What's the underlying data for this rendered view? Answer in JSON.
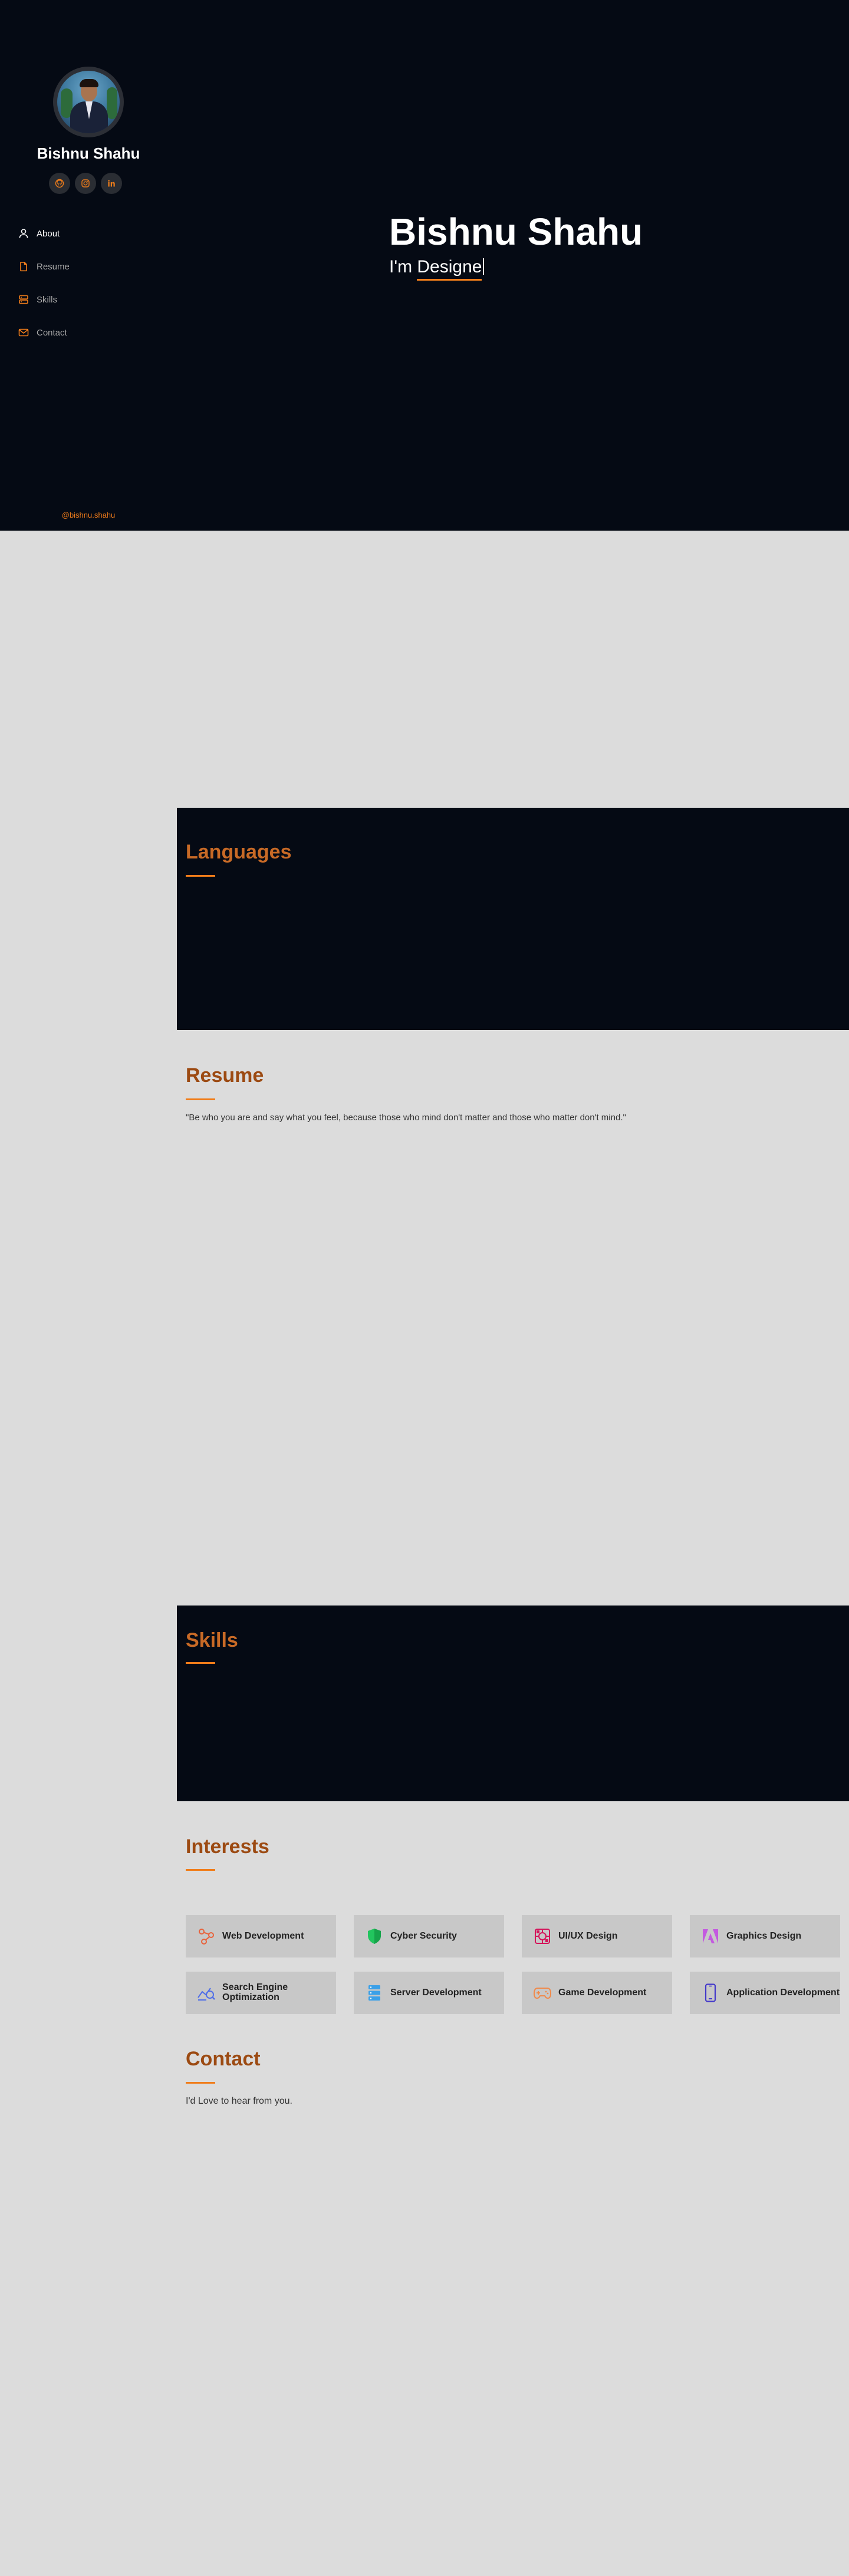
{
  "profile": {
    "name": "Bishnu Shahu",
    "footer_handle": "@bishnu.shahu"
  },
  "socials": [
    {
      "name": "github-icon"
    },
    {
      "name": "instagram-icon"
    },
    {
      "name": "linkedin-icon"
    }
  ],
  "nav": [
    {
      "label": "About",
      "icon": "user-icon",
      "active": true
    },
    {
      "label": "Resume",
      "icon": "file-icon",
      "active": false
    },
    {
      "label": "Skills",
      "icon": "server-icon",
      "active": false
    },
    {
      "label": "Contact",
      "icon": "envelope-icon",
      "active": false
    }
  ],
  "hero": {
    "title": "Bishnu Shahu",
    "prefix": "I'm ",
    "typed": "Designe"
  },
  "sections": {
    "languages": {
      "title": "Languages"
    },
    "resume": {
      "title": "Resume",
      "quote": "\"Be who you are and say what you feel, because those who mind don't matter and those who matter don't mind.\""
    },
    "skills": {
      "title": "Skills"
    },
    "interests": {
      "title": "Interests",
      "items": [
        {
          "label": "Web Development",
          "icon": "web-dev-icon",
          "color": "#e8623b"
        },
        {
          "label": "Cyber Security",
          "icon": "shield-icon",
          "color": "#22c55e"
        },
        {
          "label": "UI/UX Design",
          "icon": "uiux-icon",
          "color": "#d4145a"
        },
        {
          "label": "Graphics Design",
          "icon": "graphics-icon",
          "color": "#c45ae0"
        },
        {
          "label": "Search Engine Optimization",
          "icon": "seo-icon",
          "color": "#4f6ee8"
        },
        {
          "label": "Server Development",
          "icon": "server-dev-icon",
          "color": "#3aa0e8"
        },
        {
          "label": "Game Development",
          "icon": "gamepad-icon",
          "color": "#f08a4b"
        },
        {
          "label": "Application Development",
          "icon": "mobile-icon",
          "color": "#4338ca"
        }
      ]
    },
    "contact": {
      "title": "Contact",
      "text": "I'd Love to hear from you."
    }
  },
  "colors": {
    "accent": "#f07d1a",
    "dark_bg": "#050a14",
    "light_bg": "#dcdcdc",
    "heading": "#9c4a12"
  }
}
